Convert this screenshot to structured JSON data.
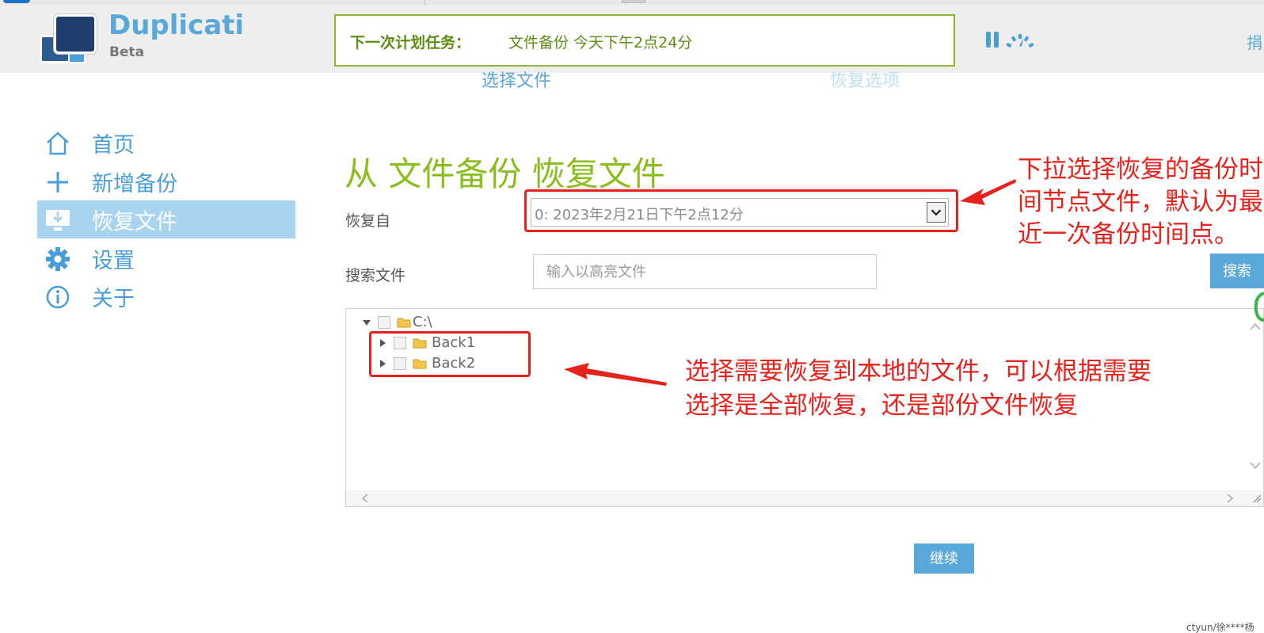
{
  "app": {
    "brand": "Duplicati",
    "brand_sub": "Beta",
    "donate": "捐"
  },
  "schedule": {
    "label": "下一次计划任务：",
    "value": "文件备份 今天下午2点24分"
  },
  "wizard": {
    "step1": "选择文件",
    "step2": "恢复选项"
  },
  "sidebar": {
    "items": [
      {
        "label": "首页",
        "icon": "home-icon"
      },
      {
        "label": "新增备份",
        "icon": "plus-icon"
      },
      {
        "label": "恢复文件",
        "icon": "restore-icon"
      },
      {
        "label": "设置",
        "icon": "gear-icon"
      },
      {
        "label": "关于",
        "icon": "info-icon"
      }
    ]
  },
  "main": {
    "title": "从 文件备份 恢复文件",
    "restore_from_label": "恢复自",
    "restore_from_value": "0: 2023年2月21日下午2点12分",
    "search_label": "搜索文件",
    "search_placeholder": "输入以高亮文件",
    "search_button": "搜索",
    "tree": {
      "root": "C:\\",
      "children": [
        "Back1",
        "Back2"
      ]
    },
    "continue_button": "继续"
  },
  "annotations": {
    "select_note": "下拉选择恢复的备份时间节点文件，默认为最近一次备份时间点。",
    "tree_note_line1": "选择需要恢复到本地的文件，可以根据需要",
    "tree_note_line2": "选择是全部恢复，还是部份文件恢复"
  },
  "colors": {
    "accent": "#5aa8d8",
    "title_green": "#8bbd1f",
    "annotation_red": "#e5231c",
    "active_nav": "#a8d4ef"
  },
  "watermark": "ctyun/徐****杨"
}
